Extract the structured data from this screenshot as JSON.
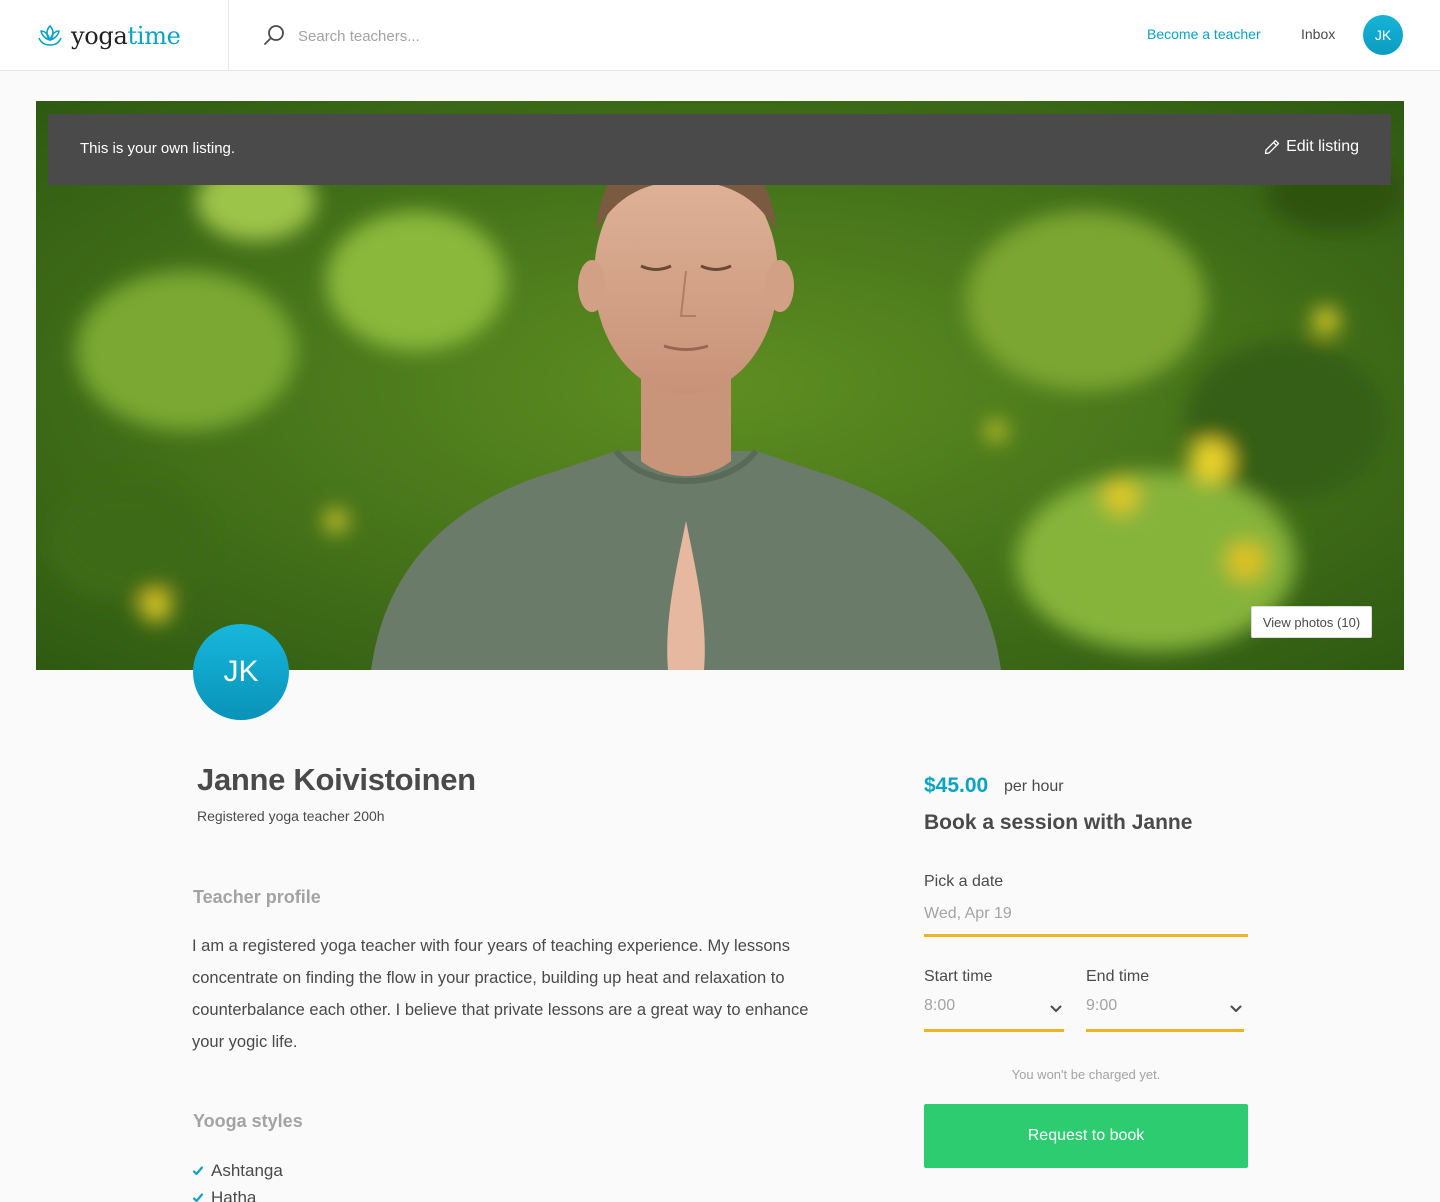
{
  "header": {
    "logo": {
      "word1": "yoga",
      "word2": "time",
      "icon": "lotus-icon"
    },
    "search": {
      "placeholder": "Search teachers..."
    },
    "nav": {
      "become_teacher": "Become a teacher",
      "inbox": "Inbox",
      "avatar_initials": "JK"
    }
  },
  "hero": {
    "own_listing_text": "This is your own listing.",
    "edit_listing_label": "Edit listing",
    "view_photos_label": "View photos (10)"
  },
  "teacher": {
    "initials": "JK",
    "name": "Janne Koivistoinen",
    "subtitle": "Registered yoga teacher 200h",
    "profile_title": "Teacher profile",
    "description": "I am a registered yoga teacher with four years of teaching experience. My lessons concentrate on finding the flow in your practice, building up heat and relaxation to counterbalance each other. I believe that private lessons are a great way to enhance your yogic life.",
    "styles_title": "Yooga styles",
    "styles": [
      "Ashtanga",
      "Hatha"
    ]
  },
  "booking": {
    "price": "$45.00",
    "unit": "per hour",
    "title": "Book a session with Janne",
    "date_label": "Pick a date",
    "date_value": "Wed, Apr 19",
    "start_label": "Start time",
    "start_value": "8:00",
    "end_label": "End time",
    "end_value": "9:00",
    "note": "You won't be charged yet.",
    "button_label": "Request to book"
  },
  "colors": {
    "brand": "#0aa3c2",
    "input_underline": "#f0b323",
    "cta": "#2ecc71",
    "muted_text": "#a3a3a3"
  }
}
